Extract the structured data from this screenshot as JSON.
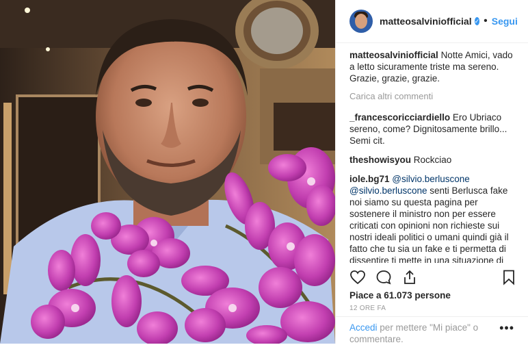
{
  "post": {
    "username": "matteosalviniofficial",
    "follow_label": "Segui",
    "separator": "•"
  },
  "comments": [
    {
      "user": "matteosalviniofficial",
      "text": "Notte Amici, vado a letto sicuramente triste ma sereno. Grazie, grazie, grazie."
    },
    {
      "user": "_francescoricciardiello",
      "text": "Ero Ubriaco sereno, come? Dignitosamente brillo... Semi cit."
    },
    {
      "user": "theshowisyou",
      "text": "Rockciao"
    },
    {
      "user": "iole.bg71",
      "mention": "@silvio.berluscone",
      "mention2": "@silvio.berluscone",
      "text": "senti Berlusca fake noi siamo su questa pagina per sostenere il ministro non per essere criticati con opinioni non richieste sui nostri ideali politici o umani quindi già il fatto che tu sia un fake e ti permetta di dissentire ti mette in una situazione di ipocrisia e di incoerenza totali. Meglio che ti dissolvi in altre pagine più appropriate ai buffoni rosiconi come te che si celano dietro una"
    }
  ],
  "load_more": "Carica altri commenti",
  "likes": "Piace a 61.073 persone",
  "time": "12 ORE FA",
  "login": {
    "link": "Accedi",
    "text": "per mettere \"Mi piace\" o commentare."
  },
  "more_options": "•••",
  "colors": {
    "accent": "#3897f0",
    "orchid": "#c23fb0"
  }
}
